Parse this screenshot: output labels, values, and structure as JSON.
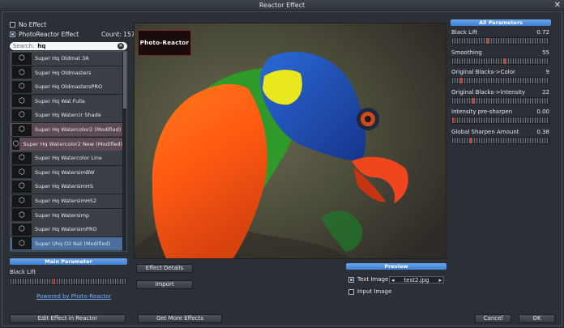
{
  "window": {
    "title": "Reactor Effect",
    "close_glyph": "✕"
  },
  "mode": {
    "no_effect": "No Effect",
    "photoreactor_effect": "PhotoReactor Effect",
    "count_label": "Count: 157"
  },
  "search": {
    "label": "Search:",
    "value": "hq",
    "clear_icon": "clear-icon"
  },
  "effects": [
    {
      "name": "Super Hq Oldmat 3A",
      "state": "normal"
    },
    {
      "name": "Super Hq Oldmasters",
      "state": "normal"
    },
    {
      "name": "Super Hq OldmastersPRO",
      "state": "normal"
    },
    {
      "name": "Super Hq Wat Fulla",
      "state": "normal"
    },
    {
      "name": "Super Hq Watercir Shade",
      "state": "normal"
    },
    {
      "name": "Super Hq Watercolor2 (Modified)",
      "state": "modified"
    },
    {
      "name": "Super Hq Watercolor2 New (Modified)",
      "state": "modified"
    },
    {
      "name": "Super Hq Watercolor Line",
      "state": "normal"
    },
    {
      "name": "Super Hq WatersimBW",
      "state": "normal"
    },
    {
      "name": "Super Hq WatersimHS",
      "state": "normal"
    },
    {
      "name": "Super Hq WatersimHS2",
      "state": "normal"
    },
    {
      "name": "Super Hq Watersimp",
      "state": "normal"
    },
    {
      "name": "Super Hq WatersimPRO",
      "state": "normal"
    },
    {
      "name": "Super Uhq Oil Nat (Modified)",
      "state": "selected"
    }
  ],
  "main_parameter": {
    "header": "Main Parameter",
    "label": "Black Lift",
    "value_fraction": 0.37
  },
  "powered_by": "Powered by Photo-Reactor",
  "center_buttons": {
    "effect_details": "Effect Details",
    "import": "Import"
  },
  "preview": {
    "header": "Preview",
    "text_image": "Text Image",
    "input_image": "Input Image",
    "filename": "test2.jpg",
    "prev_icon": "◂",
    "next_icon": "▸"
  },
  "logo_text": "Photo-Reactor",
  "all_parameters": {
    "header": "All Parameters",
    "params": [
      {
        "label": "Black Lift",
        "value": "0.72",
        "fraction": 0.37
      },
      {
        "label": "Smoothing",
        "value": "55",
        "fraction": 0.55
      },
      {
        "label": "Original Blacks->Color",
        "value": "9",
        "fraction": 0.09
      },
      {
        "label": "Original Blacks->Intensity",
        "value": "22",
        "fraction": 0.22
      },
      {
        "label": "Intensity pre-sharpen",
        "value": "0.00",
        "fraction": 0.0
      },
      {
        "label": "Global Sharpen Amount",
        "value": "0.38",
        "fraction": 0.19
      }
    ]
  },
  "footer": {
    "edit_effect": "Edit Effect in Reactor",
    "get_more": "Get More Effects",
    "cancel": "Cancel",
    "ok": "OK"
  }
}
